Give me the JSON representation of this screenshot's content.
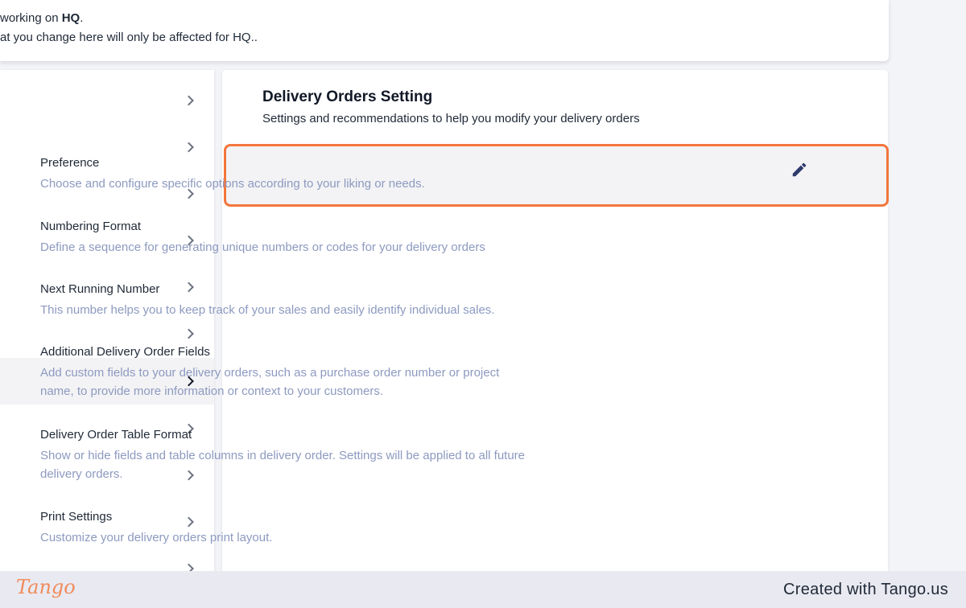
{
  "notice": {
    "line1_prefix": "working on ",
    "line1_strong": "HQ",
    "line1_suffix": ".",
    "line2": "at you change here will only be affected for HQ.."
  },
  "sidebar": {
    "items": [
      {
        "active": false
      },
      {
        "active": false
      },
      {
        "active": false
      },
      {
        "active": false
      },
      {
        "active": false
      },
      {
        "active": false
      },
      {
        "active": true
      },
      {
        "active": false
      },
      {
        "active": false
      },
      {
        "active": false
      },
      {
        "active": false
      }
    ]
  },
  "main": {
    "title": "Delivery Orders Setting",
    "subtitle": "Settings and recommendations to help you modify your delivery orders",
    "items": [
      {
        "title": "Preference",
        "desc": "Choose and configure specific options according to your liking or needs."
      },
      {
        "title": "Numbering Format",
        "desc": "Define a sequence for generating unique numbers or codes for your delivery orders"
      },
      {
        "title": "Next Running Number",
        "desc": "This number helps you to keep track of your sales and easily identify individual sales."
      },
      {
        "title": "Additional Delivery Order Fields",
        "desc": "Add custom fields to your delivery orders, such as a purchase order number or project name, to provide more information or context to your customers."
      },
      {
        "title": "Delivery Order Table Format",
        "desc": "Show or hide fields and table columns in delivery order. Settings will be applied to all future delivery orders."
      },
      {
        "title": "Print Settings",
        "desc": "Customize your delivery orders print layout."
      }
    ]
  },
  "icons": {
    "edit": "pencil-icon",
    "chevron": "chevron-right-icon"
  },
  "colors": {
    "highlight": "#f4763c",
    "desc_text": "#8d9ac0",
    "edit_icon": "#2e3a6b"
  },
  "footer": {
    "logo": "Tango",
    "credit": "Created with Tango.us"
  }
}
